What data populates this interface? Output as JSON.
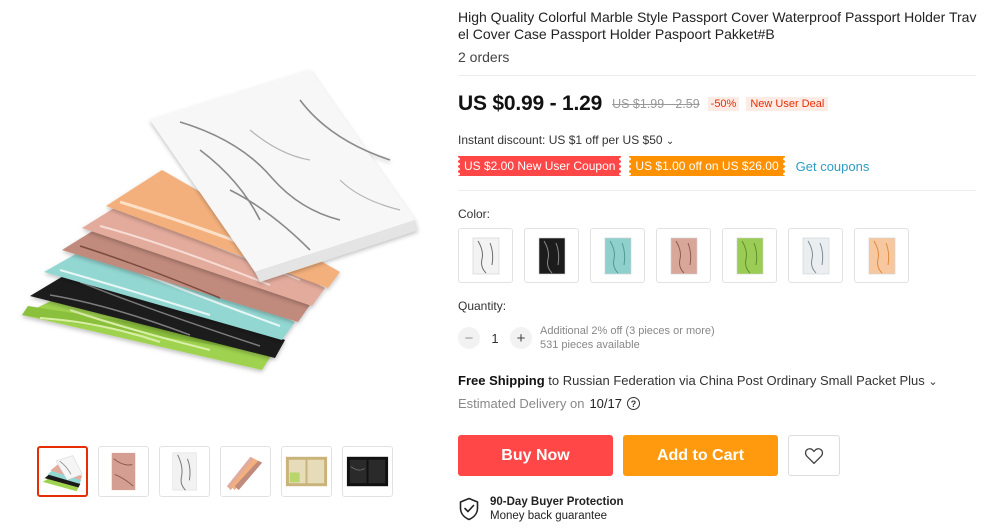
{
  "product": {
    "title": "High Quality Colorful Marble Style Passport Cover Waterproof Passport Holder Travel Cover Case Passport Holder Paspoort Pakket#B",
    "orders": "2 orders"
  },
  "gallery": {
    "main_image": "marble-passport-covers-fan",
    "thumbnails": [
      {
        "icon": "passport-covers-fan-thumbnail",
        "active": true
      },
      {
        "icon": "pink-marble-cover-thumbnail",
        "active": false
      },
      {
        "icon": "white-marble-cover-thumbnail",
        "active": false
      },
      {
        "icon": "covers-side-view-thumbnail",
        "active": false
      },
      {
        "icon": "cover-inside-view-thumbnail",
        "active": false
      },
      {
        "icon": "black-marble-open-thumbnail",
        "active": false
      }
    ]
  },
  "pricing": {
    "price": "US $0.99 - 1.29",
    "original_price": "US $1.99 - 2.59",
    "discount_percent": "-50%",
    "deal_badge": "New User Deal",
    "instant_discount": "Instant discount: US $1 off per US $50",
    "coupons": [
      "US $2.00 New User Coupon",
      "US $1.00 off on US $26.00"
    ],
    "get_coupons": "Get coupons"
  },
  "color": {
    "label": "Color:",
    "options": [
      {
        "name": "white-marble-swatch",
        "base": "#f3f3f3",
        "vein": "#6b6b6b"
      },
      {
        "name": "black-marble-swatch",
        "base": "#1c1c1c",
        "vein": "#8a8a8a"
      },
      {
        "name": "teal-marble-swatch",
        "base": "#8fd0cc",
        "vein": "#4f9a96"
      },
      {
        "name": "pink-marble-swatch",
        "base": "#d8a79a",
        "vein": "#8e5a4e"
      },
      {
        "name": "green-marble-swatch",
        "base": "#9bcc55",
        "vein": "#5f8f2a"
      },
      {
        "name": "grey-marble-swatch",
        "base": "#eaeef0",
        "vein": "#7f8c92"
      },
      {
        "name": "orange-marble-swatch",
        "base": "#f7c8a0",
        "vein": "#e08a3a"
      }
    ]
  },
  "quantity": {
    "label": "Quantity:",
    "minus": "−",
    "value": "1",
    "plus": "+",
    "note_discount": "Additional 2% off (3 pieces or more)",
    "note_available": "531 pieces available"
  },
  "shipping": {
    "free_label": "Free Shipping",
    "destination": " to Russian Federation via China Post Ordinary Small Packet Plus",
    "chevron": "⌄",
    "estimated_label": "Estimated Delivery on",
    "estimated_date": "10/17",
    "help": "?"
  },
  "actions": {
    "buy_now": "Buy Now",
    "add_to_cart": "Add to Cart"
  },
  "protection": {
    "title": "90-Day Buyer Protection",
    "subtitle": "Money back guarantee"
  },
  "colors": {
    "price_red": "#e62e04",
    "buy_now": "#ff4747",
    "add_to_cart": "#ff9a0e",
    "link_blue": "#2e9cc3",
    "coupon_red": "#ff4747",
    "coupon_orange": "#ff9000"
  }
}
